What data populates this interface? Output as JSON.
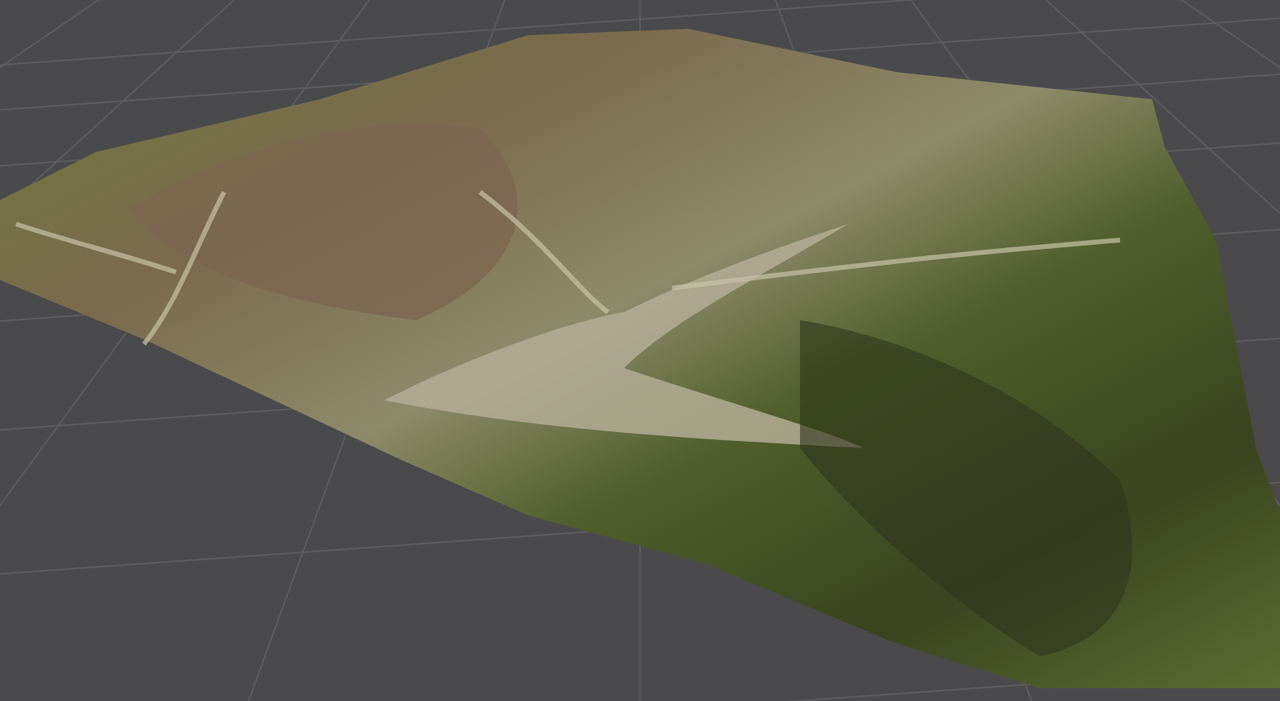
{
  "scene": {
    "grid": true
  }
}
